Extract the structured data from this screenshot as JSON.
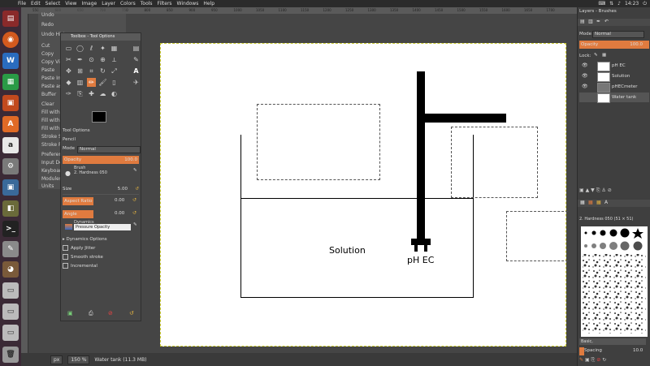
{
  "topbar": {
    "menus": [
      "File",
      "Edit",
      "Select",
      "View",
      "Image",
      "Layer",
      "Colors",
      "Tools",
      "Filters",
      "Windows",
      "Help"
    ],
    "clock": "14:23"
  },
  "launcher": {
    "icons": [
      "files-icon",
      "firefox-icon",
      "writer-icon",
      "calc-icon",
      "impress-icon",
      "software-icon",
      "amazon-icon",
      "settings-icon",
      "vmware-icon",
      "terminal-icon",
      "editor-icon",
      "gimp-icon",
      "drive-icon",
      "drive-icon",
      "drive-icon",
      "trash-icon"
    ]
  },
  "ruler": {
    "ticks": [
      "550",
      "600",
      "650",
      "700",
      "750",
      "800",
      "850",
      "900",
      "950",
      "1000",
      "1050",
      "1100",
      "1150",
      "1200",
      "1250",
      "1300",
      "1350",
      "1400",
      "1450",
      "1500",
      "1550",
      "1600",
      "1650",
      "1700"
    ]
  },
  "editmenu": {
    "items": [
      "Undo",
      "Redo",
      "Undo History",
      "Cut",
      "Copy",
      "Copy Visible",
      "Paste",
      "Paste In Place",
      "Paste as",
      "Buffer",
      "Clear",
      "Fill with FG Color",
      "Fill with BG Color",
      "Fill with Pattern",
      "Stroke Selection...",
      "Stroke Path...",
      "Preferences",
      "Input Devices",
      "Keyboard Shortcuts",
      "Modules",
      "Units"
    ]
  },
  "toolbox": {
    "title": "Toolbox - Tool Options",
    "tool_options_label": "Tool Options",
    "tool_name": "Pencil",
    "mode_label": "Mode",
    "mode_value": "Normal",
    "opacity_label": "Opacity",
    "opacity_value": "100.0",
    "brush_label": "Brush",
    "brush_value": "2. Hardness 050",
    "size_label": "Size",
    "size_value": "5.00",
    "aspect_label": "Aspect Ratio",
    "aspect_value": "0.00",
    "angle_label": "Angle",
    "angle_value": "0.00",
    "dynamics_label": "Dynamics",
    "dynamics_value": "Pressure Opacity",
    "dynamics_options": "Dynamics Options",
    "apply_jitter": "Apply Jitter",
    "smooth_stroke": "Smooth stroke",
    "incremental": "Incremental"
  },
  "canvas": {
    "solution_label": "Solution",
    "ph_label": "pH EC"
  },
  "statusbar": {
    "unit": "px",
    "zoom": "150 %",
    "info": "Water tank (11.3 MB)"
  },
  "dock": {
    "title": "Layers - Brushes",
    "mode_label": "Mode",
    "mode_value": "Normal",
    "opacity_label": "Opacity",
    "opacity_value": "100.0",
    "lock_label": "Lock:",
    "layers": [
      {
        "name": "pH EC",
        "visible": true
      },
      {
        "name": "Solution",
        "visible": true
      },
      {
        "name": "pHECmeter",
        "visible": true
      },
      {
        "name": "Water tank",
        "visible": false
      }
    ],
    "brush_title": "2. Hardness 050 (51 × 51)",
    "brush_filter": "Basic,",
    "spacing_label": "Spacing",
    "spacing_value": "10.0"
  }
}
